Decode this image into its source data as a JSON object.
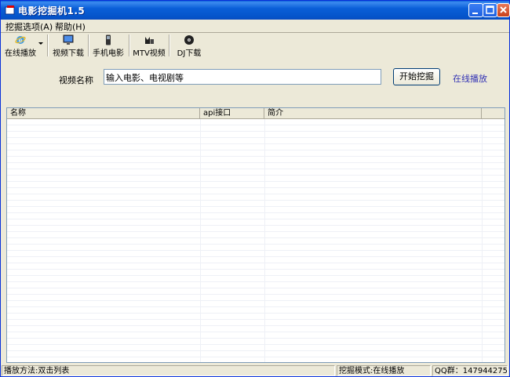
{
  "window": {
    "title": "电影挖掘机1.5",
    "accent_color": "#0a5fd8"
  },
  "menu": {
    "items": [
      {
        "label": "挖掘选项(A)"
      },
      {
        "label": "帮助(H)"
      }
    ]
  },
  "toolbar": {
    "items": [
      {
        "label": "在线播放",
        "icon": "ie-globe-icon"
      },
      {
        "label": "视频下载",
        "icon": "monitor-icon"
      },
      {
        "label": "手机电影",
        "icon": "phone-icon"
      },
      {
        "label": "MTV视频",
        "icon": "mtv-icon"
      },
      {
        "label": "DJ下载",
        "icon": "disc-icon"
      }
    ]
  },
  "search": {
    "label": "视频名称",
    "value": "输入电影、电视剧等",
    "button_label": "开始挖掘",
    "link_label": "在线播放"
  },
  "table": {
    "columns": [
      "名称",
      "api接口",
      "简介",
      ""
    ]
  },
  "status": {
    "play_method": "播放方法:双击列表",
    "mode": "挖掘模式:在线播放",
    "qq": "QQ群：147944275"
  }
}
